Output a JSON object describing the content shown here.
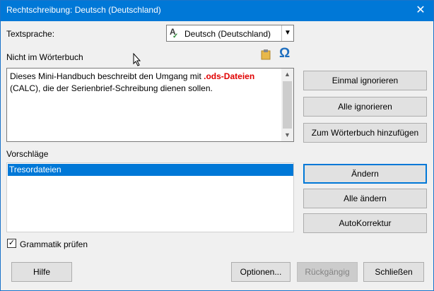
{
  "window": {
    "title": "Rechtschreibung: Deutsch (Deutschland)",
    "close_glyph": "✕"
  },
  "language": {
    "label": "Textsprache:",
    "selected": "Deutsch (Deutschland)"
  },
  "not_in_dictionary": {
    "label": "Nicht im Wörterbuch",
    "text_before": "Dieses Mini-Handbuch beschreibt den Umgang mit ",
    "error_word": ".ods-Dateien",
    "text_after": "(CALC), die der Serienbrief-Schreibung dienen sollen."
  },
  "suggestions": {
    "label": "Vorschläge",
    "items": [
      "Tresordateien"
    ]
  },
  "grammar": {
    "label": "Grammatik prüfen",
    "checked": true
  },
  "buttons": {
    "ignore_once": "Einmal ignorieren",
    "ignore_all": "Alle ignorieren",
    "add_to_dictionary": "Zum Wörterbuch hinzufügen",
    "change": "Ändern",
    "change_all": "Alle ändern",
    "autocorrect": "AutoKorrektur",
    "help": "Hilfe",
    "options": "Optionen...",
    "undo": "Rückgängig",
    "close": "Schließen"
  },
  "colors": {
    "titlebar": "#0078d7",
    "selection": "#0078d7",
    "error_text": "#e00000"
  },
  "icons": [
    "language-check-icon",
    "clipboard-icon",
    "omega-icon",
    "mouse-cursor-icon",
    "checkbox-checked-icon"
  ]
}
